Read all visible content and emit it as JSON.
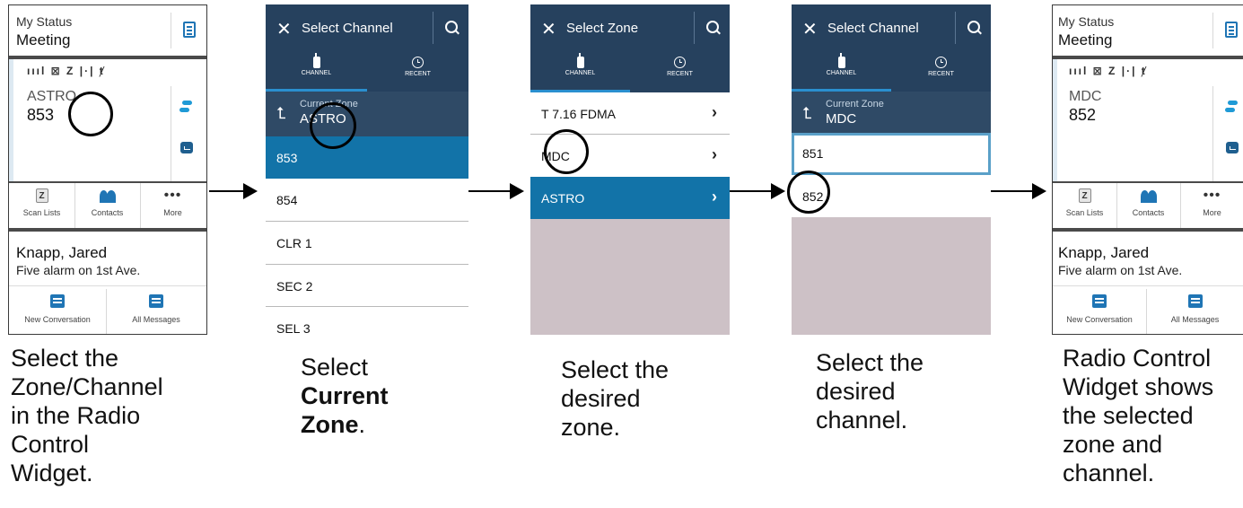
{
  "widget_before": {
    "status_label": "My Status",
    "status_value": "Meeting",
    "zone": "ASTRO",
    "channel": "853",
    "buttons": [
      "Scan Lists",
      "Contacts",
      "More"
    ],
    "contact_name": "Knapp, Jared",
    "message": "Five alarm on 1st Ave.",
    "actions": [
      "New Conversation",
      "All Messages"
    ]
  },
  "widget_after": {
    "status_label": "My Status",
    "status_value": "Meeting",
    "zone": "MDC",
    "channel": "852",
    "buttons": [
      "Scan Lists",
      "Contacts",
      "More"
    ],
    "contact_name": "Knapp, Jared",
    "message": "Five alarm on 1st Ave.",
    "actions": [
      "New Conversation",
      "All Messages"
    ]
  },
  "select_channel_1": {
    "title": "Select Channel",
    "tabs": [
      "CHANNEL",
      "RECENT"
    ],
    "current_zone_label": "Current Zone",
    "current_zone": "ASTRO",
    "channels": [
      "853",
      "854",
      "CLR 1",
      "SEC 2",
      "SEL 3"
    ],
    "selected_index": 0
  },
  "select_zone": {
    "title": "Select Zone",
    "tabs": [
      "CHANNEL",
      "RECENT"
    ],
    "zones": [
      "T 7.16 FDMA",
      "MDC",
      "ASTRO"
    ],
    "selected_index": 2
  },
  "select_channel_2": {
    "title": "Select Channel",
    "tabs": [
      "CHANNEL",
      "RECENT"
    ],
    "current_zone_label": "Current Zone",
    "current_zone": "MDC",
    "channels": [
      "851",
      "852"
    ]
  },
  "captions": {
    "step1": [
      "Select the",
      "Zone/Channel",
      "in the Radio",
      "Control",
      "Widget."
    ],
    "step2_prefix": "Select",
    "step2_bold1": "Current",
    "step2_bold2": "Zone",
    "step2_suffix": ".",
    "step3": [
      "Select the",
      "desired",
      "zone."
    ],
    "step4": [
      "Select the",
      "desired",
      "channel."
    ],
    "step5": [
      "Radio Control",
      "Widget shows",
      "the selected",
      "zone and",
      "channel."
    ]
  },
  "colors": {
    "header_navy": "#26415e",
    "selected_blue": "#1273a8",
    "accent_blue": "#1f75b5",
    "empty_area": "#cdc1c6"
  }
}
